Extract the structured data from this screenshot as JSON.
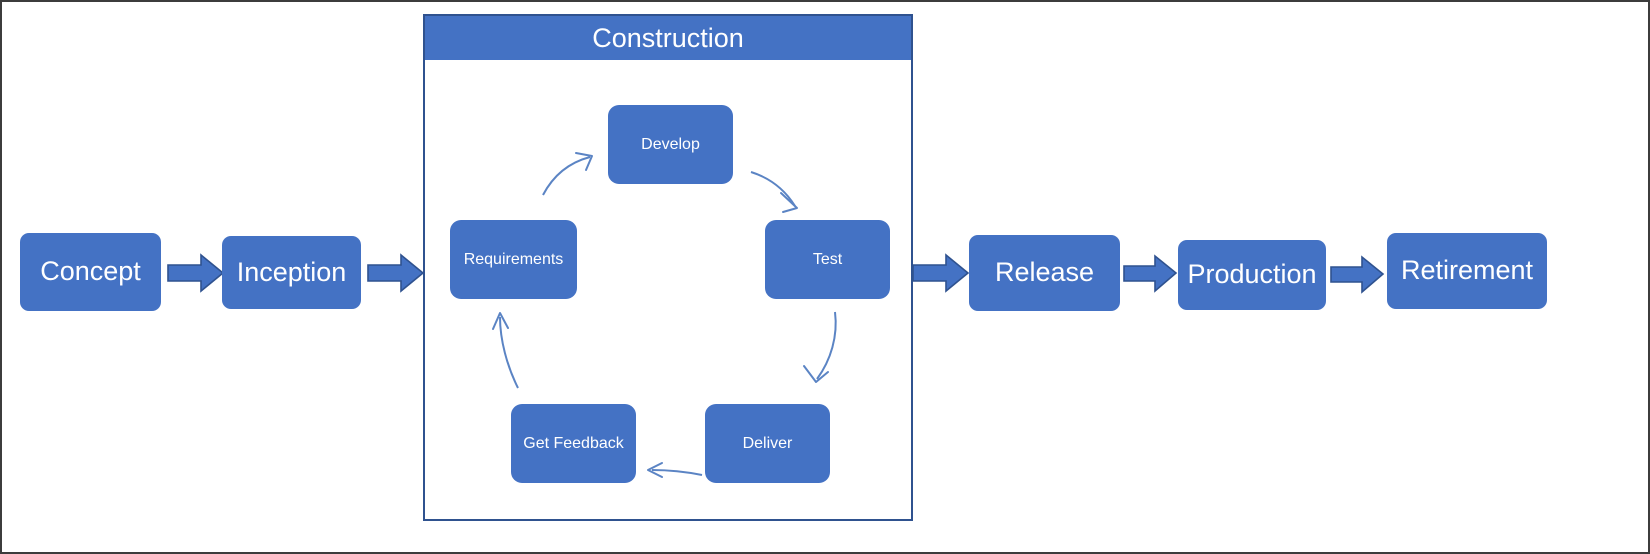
{
  "diagram": {
    "title_visible": false,
    "colors": {
      "box_fill": "#4472C4",
      "box_text": "#FFFFFF",
      "arrow_fill": "#4472C4",
      "arrow_stroke": "#2F528F",
      "panel_border": "#2F528F",
      "curve_stroke": "#5B84C4",
      "frame_border": "#3C3C3C",
      "background": "#FFFFFF"
    },
    "outer_stages": [
      {
        "id": "concept",
        "label": "Concept"
      },
      {
        "id": "inception",
        "label": "Inception"
      },
      {
        "id": "release",
        "label": "Release"
      },
      {
        "id": "production",
        "label": "Production"
      },
      {
        "id": "retirement",
        "label": "Retirement"
      }
    ],
    "container": {
      "id": "construction",
      "label": "Construction"
    },
    "cycle_stages": [
      {
        "id": "develop",
        "label": "Develop"
      },
      {
        "id": "test",
        "label": "Test"
      },
      {
        "id": "deliver",
        "label": "Deliver"
      },
      {
        "id": "get-feedback",
        "label": "Get Feedback"
      },
      {
        "id": "requirements",
        "label": "Requirements"
      }
    ],
    "flow_arrows": [
      {
        "id": "concept-to-inception",
        "from": "Concept",
        "to": "Inception"
      },
      {
        "id": "inception-to-construction",
        "from": "Inception",
        "to": "Construction"
      },
      {
        "id": "construction-to-release",
        "from": "Construction",
        "to": "Release"
      },
      {
        "id": "release-to-production",
        "from": "Release",
        "to": "Production"
      },
      {
        "id": "production-to-retirement",
        "from": "Production",
        "to": "Retirement"
      }
    ],
    "cycle_arrows": [
      {
        "id": "requirements-to-develop",
        "from": "Requirements",
        "to": "Develop"
      },
      {
        "id": "develop-to-test",
        "from": "Develop",
        "to": "Test"
      },
      {
        "id": "test-to-deliver",
        "from": "Test",
        "to": "Deliver"
      },
      {
        "id": "deliver-to-get-feedback",
        "from": "Deliver",
        "to": "Get Feedback"
      },
      {
        "id": "get-feedback-to-requirements",
        "from": "Get Feedback",
        "to": "Requirements"
      }
    ]
  }
}
